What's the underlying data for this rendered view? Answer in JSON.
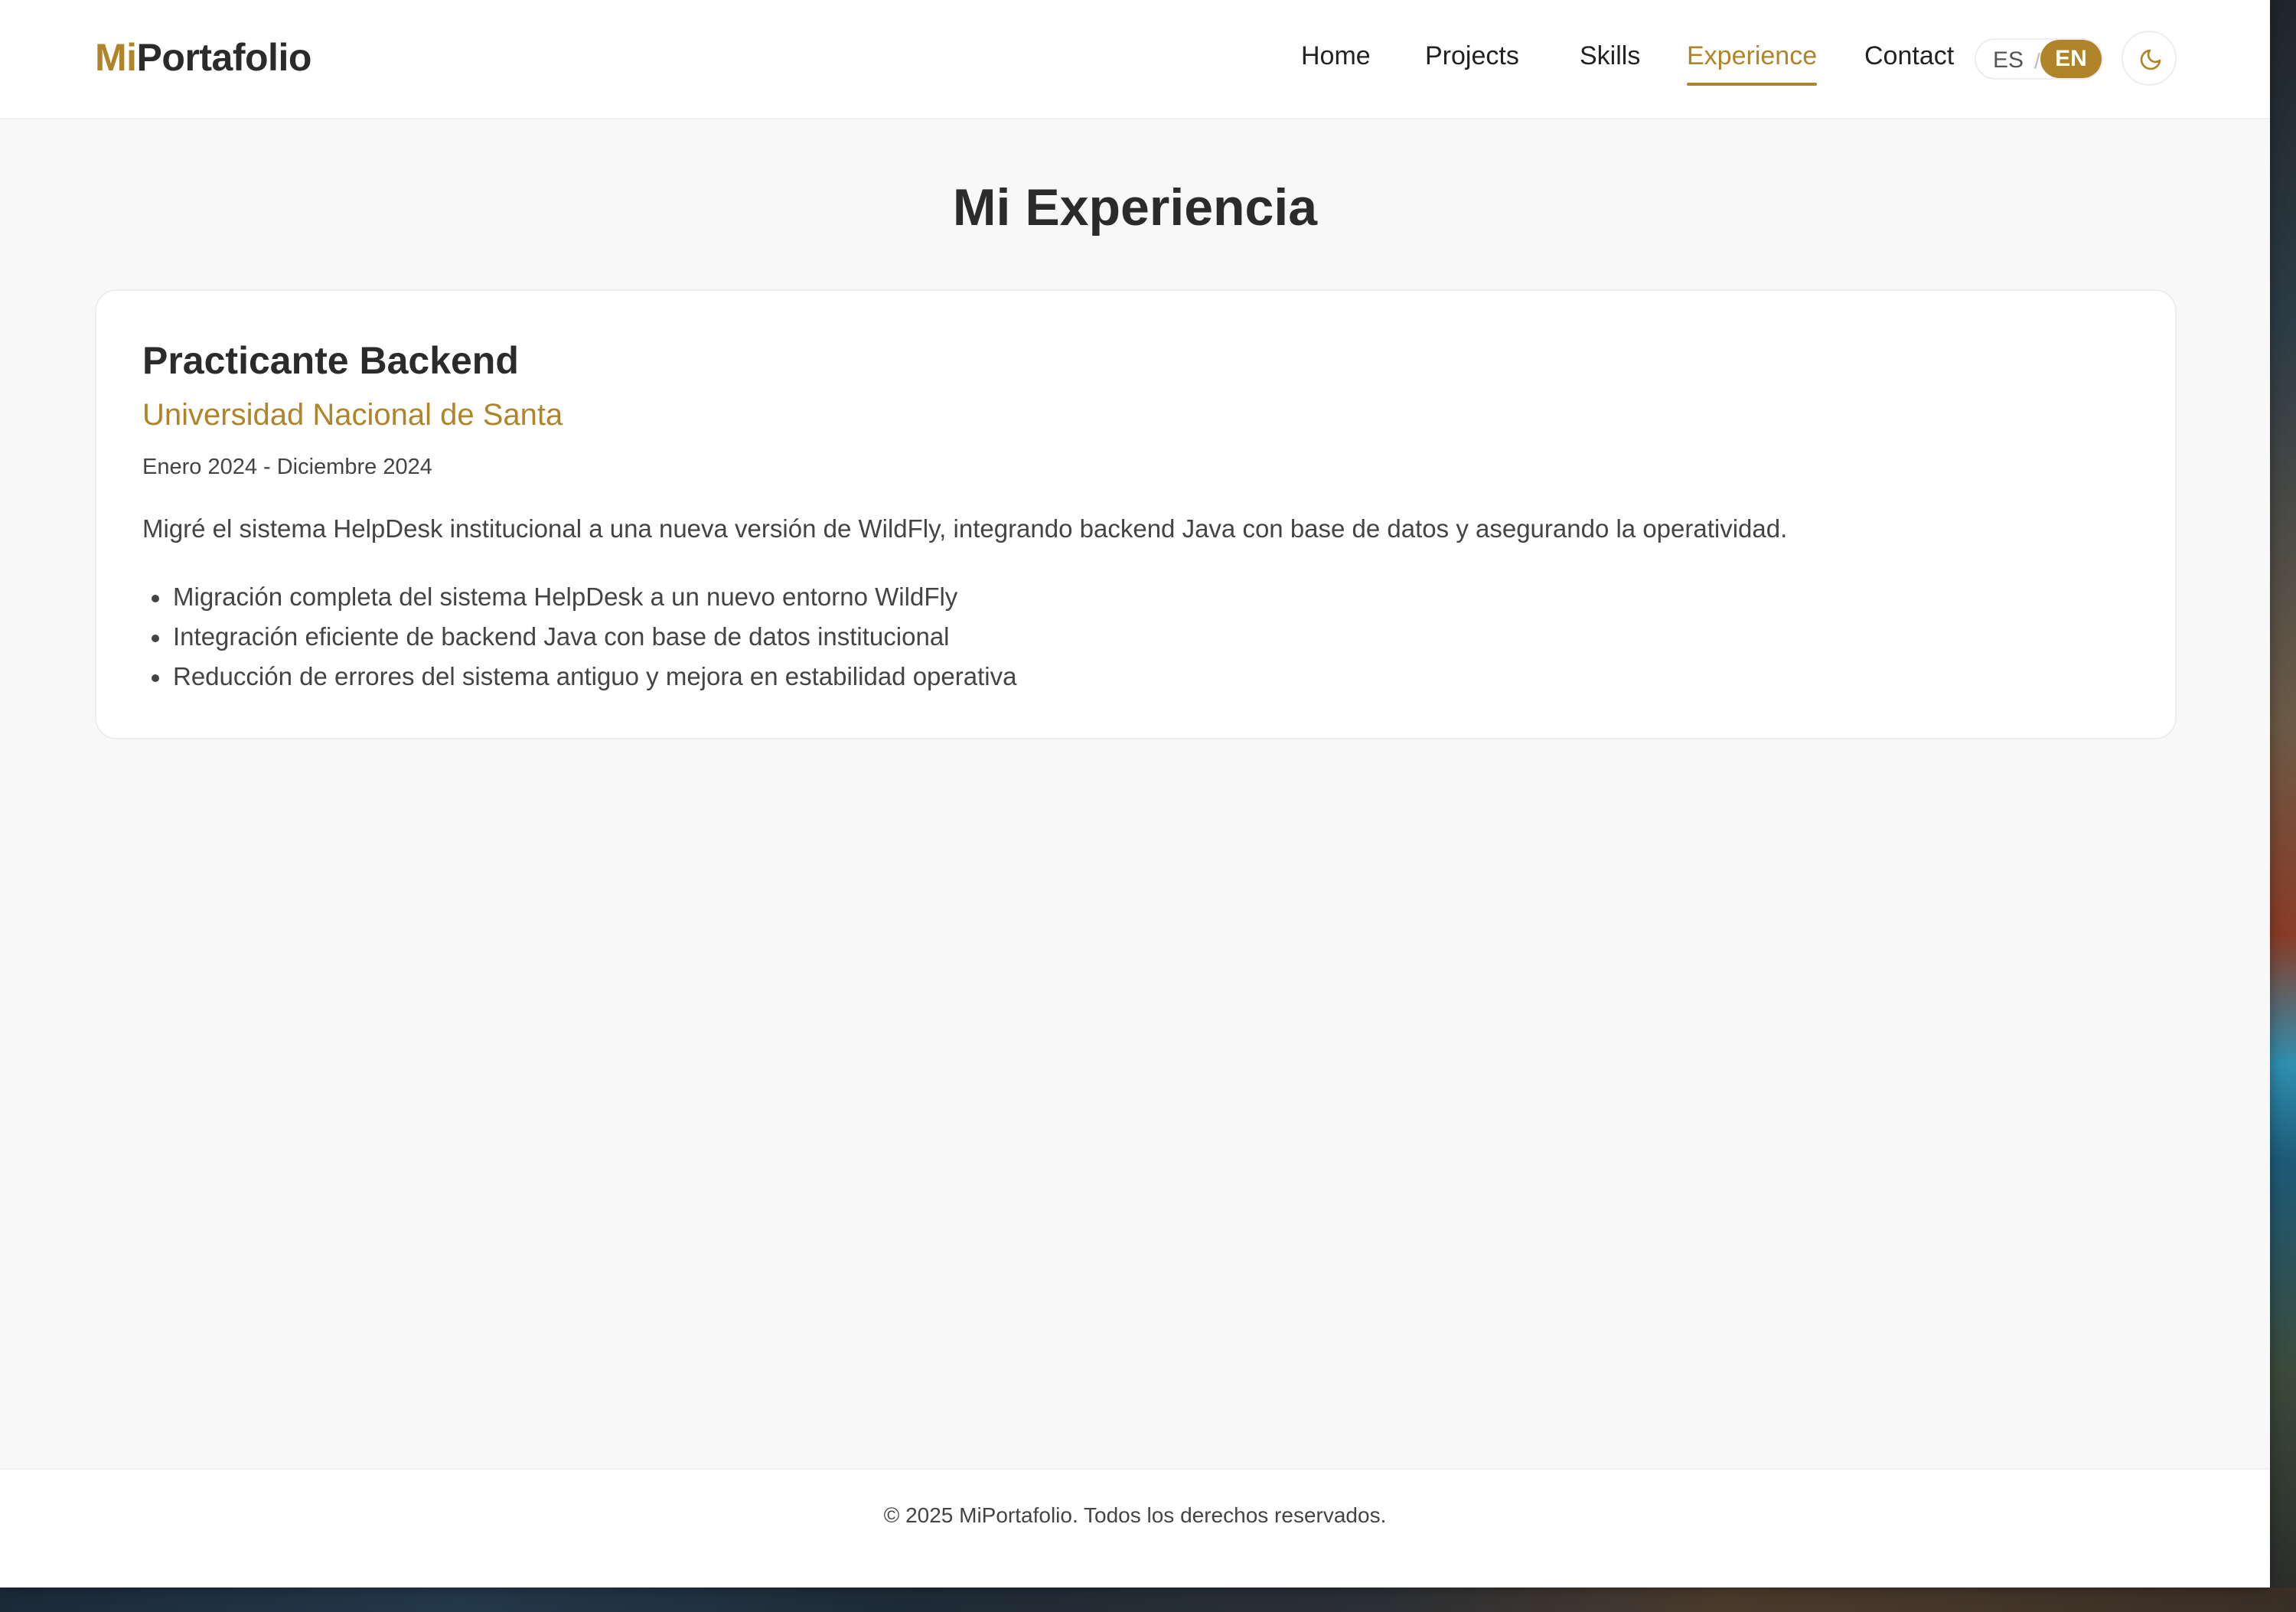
{
  "brand": {
    "accent_part": "Mi",
    "rest_part": "Portafolio",
    "accent_color": "#b08428"
  },
  "nav": {
    "items": [
      {
        "label": "Home",
        "active": false
      },
      {
        "label": "Projects",
        "active": false
      },
      {
        "label": "Skills",
        "active": false
      },
      {
        "label": "Experience",
        "active": true
      },
      {
        "label": "Contact",
        "active": false
      }
    ]
  },
  "language": {
    "es_label": "ES",
    "separator": "/",
    "en_label": "EN",
    "selected": "EN"
  },
  "theme_toggle": {
    "icon": "moon-icon"
  },
  "page": {
    "title": "Mi Experiencia"
  },
  "experience": [
    {
      "role": "Practicante Backend",
      "company": "Universidad Nacional de Santa",
      "period": "Enero 2024 - Diciembre 2024",
      "description": "Migré el sistema HelpDesk institucional a una nueva versión de WildFly, integrando backend Java con base de datos y asegurando la operatividad.",
      "achievements": [
        "Migración completa del sistema HelpDesk a un nuevo entorno WildFly",
        "Integración eficiente de backend Java con base de datos institucional",
        "Reducción de errores del sistema antiguo y mejora en estabilidad operativa"
      ]
    }
  ],
  "footer": {
    "text": "© 2025 MiPortafolio. Todos los derechos reservados."
  }
}
